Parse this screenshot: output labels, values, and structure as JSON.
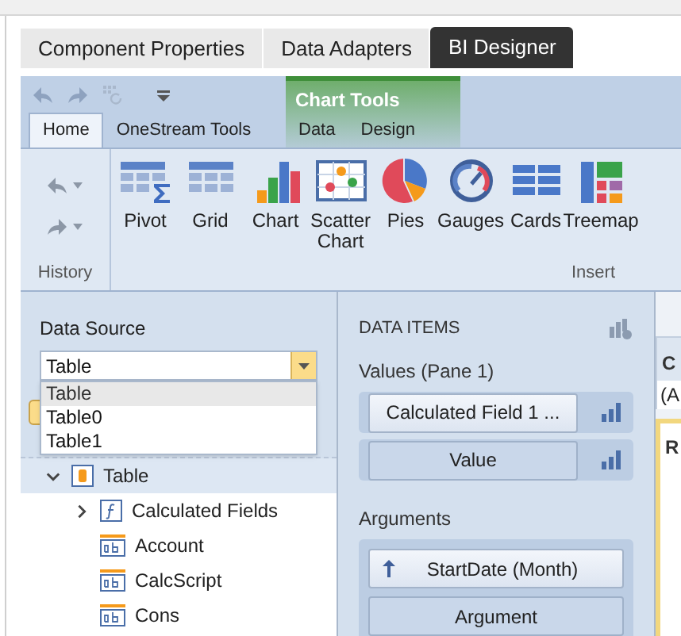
{
  "outer_tabs": [
    {
      "label": "Component Properties",
      "selected": false
    },
    {
      "label": "Data Adapters",
      "selected": false
    },
    {
      "label": "BI Designer",
      "selected": true
    }
  ],
  "ribbon": {
    "contextual_group": "Chart Tools",
    "tabs": [
      {
        "label": "Home",
        "selected": true,
        "contextual": false
      },
      {
        "label": "OneStream Tools",
        "selected": false,
        "contextual": false
      },
      {
        "label": "Data",
        "selected": false,
        "contextual": true
      },
      {
        "label": "Design",
        "selected": false,
        "contextual": true
      }
    ],
    "history_group": "History",
    "insert_group": "Insert",
    "insert_items": [
      {
        "label": "Pivot",
        "kind": "pivot"
      },
      {
        "label": "Grid",
        "kind": "grid"
      },
      {
        "label": "Chart",
        "kind": "chart"
      },
      {
        "label": "Scatter Chart",
        "kind": "scatter"
      },
      {
        "label": "Pies",
        "kind": "pies"
      },
      {
        "label": "Gauges",
        "kind": "gauges"
      },
      {
        "label": "Cards",
        "kind": "cards"
      },
      {
        "label": "Treemap",
        "kind": "treemap"
      }
    ]
  },
  "data_source": {
    "label": "Data Source",
    "value": "Table",
    "options": [
      {
        "label": "Table",
        "selected": true
      },
      {
        "label": "Table0",
        "selected": false
      },
      {
        "label": "Table1",
        "selected": false
      }
    ]
  },
  "tree": [
    {
      "label": "Table",
      "kind": "table",
      "expanded": true,
      "children": [
        {
          "label": "Calculated Fields",
          "kind": "calc",
          "expanded": false
        },
        {
          "label": "Account",
          "kind": "text"
        },
        {
          "label": "CalcScript",
          "kind": "text"
        },
        {
          "label": "Cons",
          "kind": "text"
        }
      ]
    }
  ],
  "data_items": {
    "title": "DATA ITEMS",
    "values_label": "Values (Pane 1)",
    "values": [
      {
        "label": "Calculated Field 1 ...",
        "empty": false
      },
      {
        "label": "Value",
        "empty": true
      }
    ],
    "arguments_label": "Arguments",
    "arguments": [
      {
        "label": "StartDate (Month)",
        "empty": false
      },
      {
        "label": "Argument",
        "empty": true
      }
    ]
  },
  "right_panel": {
    "header": "C",
    "field": "(A",
    "card_title": "R"
  }
}
